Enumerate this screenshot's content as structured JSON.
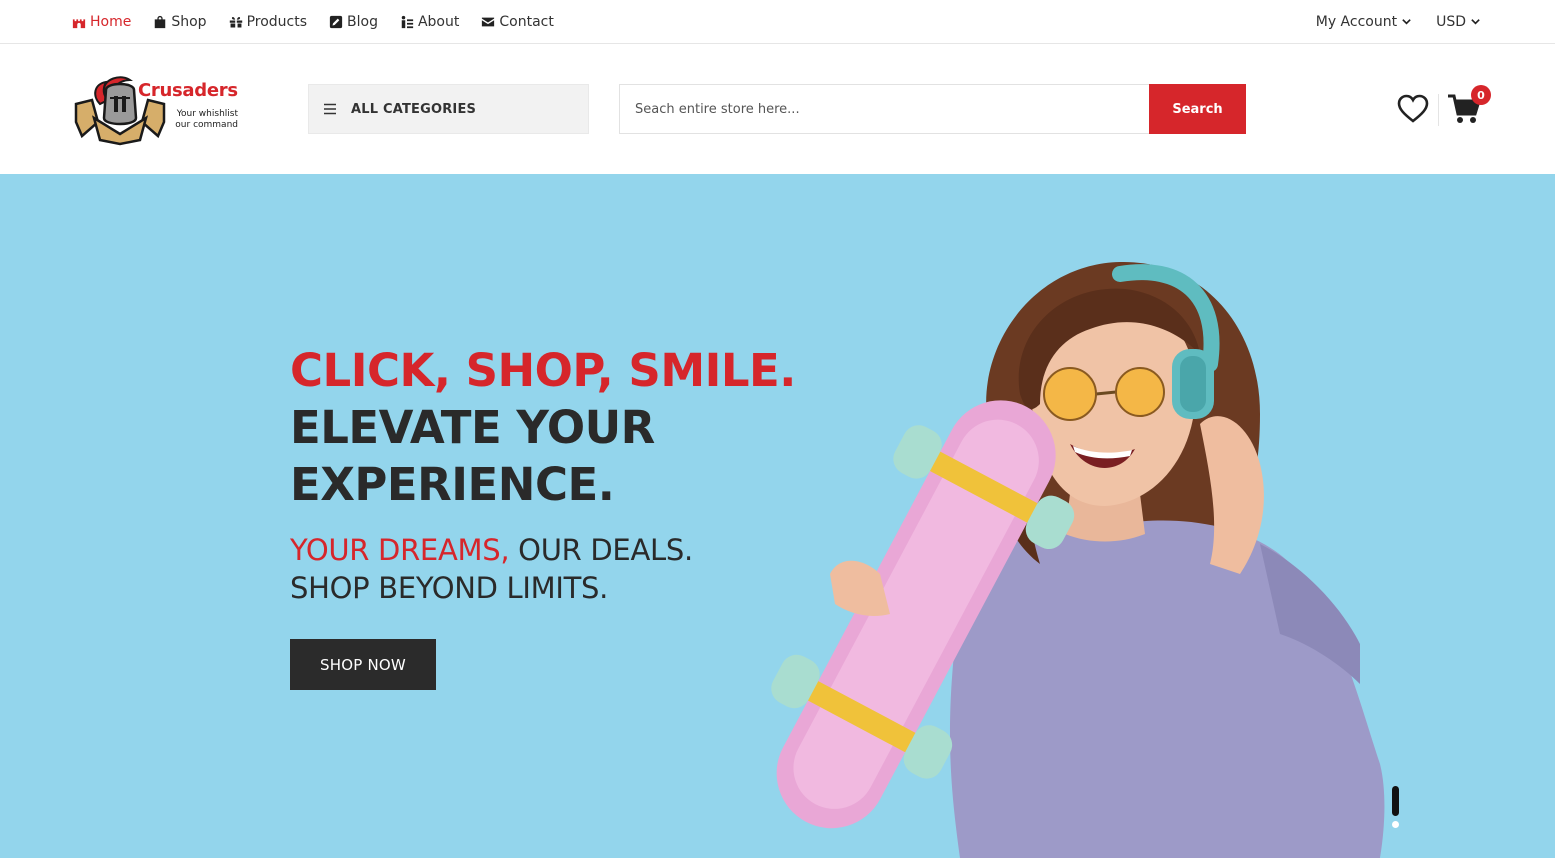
{
  "topnav": {
    "items": [
      {
        "label": "Home",
        "icon": "castle-icon",
        "active": true
      },
      {
        "label": "Shop",
        "icon": "bag-icon"
      },
      {
        "label": "Products",
        "icon": "gifts-icon"
      },
      {
        "label": "Blog",
        "icon": "pen-square-icon"
      },
      {
        "label": "About",
        "icon": "about-icon"
      },
      {
        "label": "Contact",
        "icon": "envelope-icon"
      }
    ],
    "account_label": "My Account",
    "currency_label": "USD"
  },
  "header": {
    "logo_name": "Crusaders",
    "logo_tagline_1": "Your whishlist",
    "logo_tagline_2": "our command",
    "categories_label": "ALL CATEGORIES",
    "search_placeholder": "Seach entire store here...",
    "search_button": "Search",
    "cart_count": "0"
  },
  "hero": {
    "headline_red": "CLICK, SHOP, SMILE.",
    "headline_line2": "ELEVATE YOUR",
    "headline_line3": "EXPERIENCE.",
    "sub_red": "YOUR DREAMS,",
    "sub_dark": " OUR DEALS.",
    "sub_line2": "SHOP BEYOND LIMITS.",
    "cta": "SHOP NOW"
  },
  "colors": {
    "accent": "#d6262b",
    "hero_bg": "#93d5ec",
    "dark": "#2b2b2b"
  }
}
